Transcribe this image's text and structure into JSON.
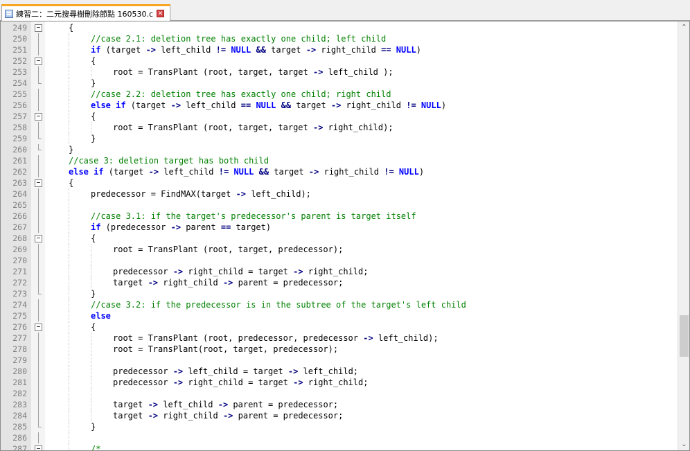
{
  "tab": {
    "title": "練習二：二元搜尋樹刪除節點 160530.c",
    "close": "✕",
    "file_icon": "file-icon"
  },
  "scrollbar": {
    "up": "⌃",
    "down": "⌄"
  },
  "colors": {
    "keyword": "#0000ff",
    "comment": "#008000",
    "operator": "#000080",
    "gutter": "#e4e4e4",
    "tab_accent": "#f6a623"
  },
  "lines": [
    {
      "n": "249",
      "fold": "box",
      "indent": 1,
      "tokens": [
        [
          "nb",
          "{"
        ]
      ]
    },
    {
      "n": "250",
      "fold": "vline",
      "indent": 2,
      "tokens": [
        [
          "cm",
          "//case 2.1: deletion tree has exactly one child; left child"
        ]
      ]
    },
    {
      "n": "251",
      "fold": "vline",
      "indent": 2,
      "tokens": [
        [
          "kw",
          "if"
        ],
        [
          "nb",
          " (target "
        ],
        [
          "op",
          "->"
        ],
        [
          "nb",
          " left_child "
        ],
        [
          "op",
          "!="
        ],
        [
          "nb",
          " "
        ],
        [
          "kw",
          "NULL"
        ],
        [
          "nb",
          " "
        ],
        [
          "op",
          "&&"
        ],
        [
          "nb",
          " target "
        ],
        [
          "op",
          "->"
        ],
        [
          "nb",
          " right_child "
        ],
        [
          "op",
          "=="
        ],
        [
          "nb",
          " "
        ],
        [
          "kw",
          "NULL"
        ],
        [
          "nb",
          ")"
        ]
      ]
    },
    {
      "n": "252",
      "fold": "box",
      "indent": 2,
      "tokens": [
        [
          "nb",
          "{"
        ]
      ]
    },
    {
      "n": "253",
      "fold": "vline",
      "indent": 3,
      "tokens": [
        [
          "nb",
          "root = TransPlant (root, target, target "
        ],
        [
          "op",
          "->"
        ],
        [
          "nb",
          " left_child );"
        ]
      ]
    },
    {
      "n": "254",
      "fold": "end",
      "indent": 2,
      "tokens": [
        [
          "nb",
          "}"
        ]
      ]
    },
    {
      "n": "255",
      "fold": "vline",
      "indent": 2,
      "tokens": [
        [
          "cm",
          "//case 2.2: deletion tree has exactly one child; right child"
        ]
      ]
    },
    {
      "n": "256",
      "fold": "vline",
      "indent": 2,
      "tokens": [
        [
          "kw",
          "else if"
        ],
        [
          "nb",
          " (target "
        ],
        [
          "op",
          "->"
        ],
        [
          "nb",
          " left_child "
        ],
        [
          "op",
          "=="
        ],
        [
          "nb",
          " "
        ],
        [
          "kw",
          "NULL"
        ],
        [
          "nb",
          " "
        ],
        [
          "op",
          "&&"
        ],
        [
          "nb",
          " target "
        ],
        [
          "op",
          "->"
        ],
        [
          "nb",
          " right_child "
        ],
        [
          "op",
          "!="
        ],
        [
          "nb",
          " "
        ],
        [
          "kw",
          "NULL"
        ],
        [
          "nb",
          ")"
        ]
      ]
    },
    {
      "n": "257",
      "fold": "box",
      "indent": 2,
      "tokens": [
        [
          "nb",
          "{"
        ]
      ]
    },
    {
      "n": "258",
      "fold": "vline",
      "indent": 3,
      "tokens": [
        [
          "nb",
          "root = TransPlant (root, target, target "
        ],
        [
          "op",
          "->"
        ],
        [
          "nb",
          " right_child);"
        ]
      ]
    },
    {
      "n": "259",
      "fold": "end",
      "indent": 2,
      "tokens": [
        [
          "nb",
          "}"
        ]
      ]
    },
    {
      "n": "260",
      "fold": "end",
      "indent": 1,
      "tokens": [
        [
          "nb",
          "}"
        ]
      ]
    },
    {
      "n": "261",
      "fold": "vline",
      "indent": 1,
      "tokens": [
        [
          "cm",
          "//case 3: deletion target has both child"
        ]
      ]
    },
    {
      "n": "262",
      "fold": "vline",
      "indent": 1,
      "tokens": [
        [
          "kw",
          "else if"
        ],
        [
          "nb",
          " (target "
        ],
        [
          "op",
          "->"
        ],
        [
          "nb",
          " left_child "
        ],
        [
          "op",
          "!="
        ],
        [
          "nb",
          " "
        ],
        [
          "kw",
          "NULL"
        ],
        [
          "nb",
          " "
        ],
        [
          "op",
          "&&"
        ],
        [
          "nb",
          " target "
        ],
        [
          "op",
          "->"
        ],
        [
          "nb",
          " right_child "
        ],
        [
          "op",
          "!="
        ],
        [
          "nb",
          " "
        ],
        [
          "kw",
          "NULL"
        ],
        [
          "nb",
          ")"
        ]
      ]
    },
    {
      "n": "263",
      "fold": "box",
      "indent": 1,
      "tokens": [
        [
          "nb",
          "{"
        ]
      ]
    },
    {
      "n": "264",
      "fold": "vline",
      "indent": 2,
      "tokens": [
        [
          "nb",
          "predecessor = FindMAX(target "
        ],
        [
          "op",
          "->"
        ],
        [
          "nb",
          " left_child);"
        ]
      ]
    },
    {
      "n": "265",
      "fold": "vline",
      "indent": 2,
      "tokens": []
    },
    {
      "n": "266",
      "fold": "vline",
      "indent": 2,
      "tokens": [
        [
          "cm",
          "//case 3.1: if the target's predecessor's parent is target itself"
        ]
      ]
    },
    {
      "n": "267",
      "fold": "vline",
      "indent": 2,
      "tokens": [
        [
          "kw",
          "if"
        ],
        [
          "nb",
          " (predecessor "
        ],
        [
          "op",
          "->"
        ],
        [
          "nb",
          " parent "
        ],
        [
          "op",
          "=="
        ],
        [
          "nb",
          " target)"
        ]
      ]
    },
    {
      "n": "268",
      "fold": "box",
      "indent": 2,
      "tokens": [
        [
          "nb",
          "{"
        ]
      ]
    },
    {
      "n": "269",
      "fold": "vline",
      "indent": 3,
      "tokens": [
        [
          "nb",
          "root = TransPlant (root, target, predecessor);"
        ]
      ]
    },
    {
      "n": "270",
      "fold": "vline",
      "indent": 3,
      "tokens": []
    },
    {
      "n": "271",
      "fold": "vline",
      "indent": 3,
      "tokens": [
        [
          "nb",
          "predecessor "
        ],
        [
          "op",
          "->"
        ],
        [
          "nb",
          " right_child = target "
        ],
        [
          "op",
          "->"
        ],
        [
          "nb",
          " right_child;"
        ]
      ]
    },
    {
      "n": "272",
      "fold": "vline",
      "indent": 3,
      "tokens": [
        [
          "nb",
          "target "
        ],
        [
          "op",
          "->"
        ],
        [
          "nb",
          " right_child "
        ],
        [
          "op",
          "->"
        ],
        [
          "nb",
          " parent = predecessor;"
        ]
      ]
    },
    {
      "n": "273",
      "fold": "end",
      "indent": 2,
      "tokens": [
        [
          "nb",
          "}"
        ]
      ]
    },
    {
      "n": "274",
      "fold": "vline",
      "indent": 2,
      "tokens": [
        [
          "cm",
          "//case 3.2: if the predecessor is in the subtree of the target's left child"
        ]
      ]
    },
    {
      "n": "275",
      "fold": "vline",
      "indent": 2,
      "tokens": [
        [
          "kw",
          "else"
        ]
      ]
    },
    {
      "n": "276",
      "fold": "box",
      "indent": 2,
      "tokens": [
        [
          "nb",
          "{"
        ]
      ]
    },
    {
      "n": "277",
      "fold": "vline",
      "indent": 3,
      "tokens": [
        [
          "nb",
          "root = TransPlant (root, predecessor, predecessor "
        ],
        [
          "op",
          "->"
        ],
        [
          "nb",
          " left_child);"
        ]
      ]
    },
    {
      "n": "278",
      "fold": "vline",
      "indent": 3,
      "tokens": [
        [
          "nb",
          "root = TransPlant(root, target, predecessor);"
        ]
      ]
    },
    {
      "n": "279",
      "fold": "vline",
      "indent": 3,
      "tokens": []
    },
    {
      "n": "280",
      "fold": "vline",
      "indent": 3,
      "tokens": [
        [
          "nb",
          "predecessor "
        ],
        [
          "op",
          "->"
        ],
        [
          "nb",
          " left_child = target "
        ],
        [
          "op",
          "->"
        ],
        [
          "nb",
          " left_child;"
        ]
      ]
    },
    {
      "n": "281",
      "fold": "vline",
      "indent": 3,
      "tokens": [
        [
          "nb",
          "predecessor "
        ],
        [
          "op",
          "->"
        ],
        [
          "nb",
          " right_child = target "
        ],
        [
          "op",
          "->"
        ],
        [
          "nb",
          " right_child;"
        ]
      ]
    },
    {
      "n": "282",
      "fold": "vline",
      "indent": 3,
      "tokens": []
    },
    {
      "n": "283",
      "fold": "vline",
      "indent": 3,
      "tokens": [
        [
          "nb",
          "target "
        ],
        [
          "op",
          "->"
        ],
        [
          "nb",
          " left_child "
        ],
        [
          "op",
          "->"
        ],
        [
          "nb",
          " parent = predecessor;"
        ]
      ]
    },
    {
      "n": "284",
      "fold": "vline",
      "indent": 3,
      "tokens": [
        [
          "nb",
          "target "
        ],
        [
          "op",
          "->"
        ],
        [
          "nb",
          " right_child "
        ],
        [
          "op",
          "->"
        ],
        [
          "nb",
          " parent = predecessor;"
        ]
      ]
    },
    {
      "n": "285",
      "fold": "end",
      "indent": 2,
      "tokens": [
        [
          "nb",
          "}"
        ]
      ]
    },
    {
      "n": "286",
      "fold": "vline",
      "indent": 2,
      "tokens": []
    },
    {
      "n": "287",
      "fold": "box",
      "indent": 2,
      "tokens": [
        [
          "cm",
          "/*"
        ]
      ]
    }
  ]
}
